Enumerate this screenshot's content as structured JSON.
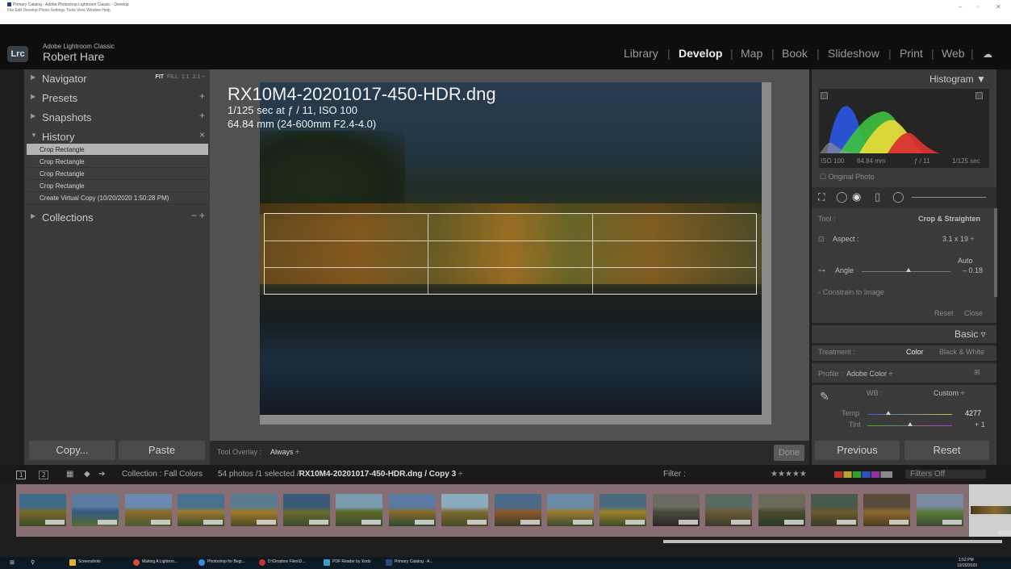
{
  "window": {
    "title": "Primary Catalog - Adobe Photoshop Lightroom Classic - Develop",
    "menu": "File  Edit  Develop  Photo  Settings  Tools  View  Window  Help",
    "controls": [
      "–",
      "▫",
      "✕"
    ]
  },
  "identity": {
    "badge": "Lrc",
    "app_name": "Adobe Lightroom Classic",
    "user_name": "Robert Hare"
  },
  "modules": [
    "Library",
    "Develop",
    "Map",
    "Book",
    "Slideshow",
    "Print",
    "Web"
  ],
  "active_module": "Develop",
  "left_panel": {
    "navigator": "Navigator",
    "nav_options": {
      "fit": "FIT",
      "fill": "FILL",
      "one": "1:1",
      "two": "2:1"
    },
    "presets": "Presets",
    "snapshots": "Snapshots",
    "history": "History",
    "history_items": [
      "Crop Rectangle",
      "Crop Rectangle",
      "Crop Rectangle",
      "Crop Rectangle",
      "Create Virtual Copy (10/20/2020 1:50:28 PM)"
    ],
    "collections": "Collections",
    "copy_button": "Copy...",
    "paste_button": "Paste"
  },
  "photo_info": {
    "filename": "RX10M4-20201017-450-HDR.dng",
    "exposure": "1/125 sec at ƒ / 11, ISO 100",
    "lens": "64.84 mm (24-600mm F2.4-4.0)"
  },
  "toolbar": {
    "overlay_label": "Tool Overlay :",
    "overlay_value": "Always ÷",
    "done": "Done"
  },
  "right_panel": {
    "histogram": "Histogram ▼",
    "hist_meta": [
      "ISO 100",
      "64.84 mm",
      "ƒ / 11",
      "1/125 sec"
    ],
    "original_photo": "Original Photo",
    "tool_label": "Tool :",
    "tool_value": "Crop & Straighten",
    "aspect_label": "Aspect :",
    "aspect_value": "3.1 x 19 ÷",
    "auto": "Auto",
    "angle_label": "Angle",
    "angle_value": "– 0.18",
    "constrain": "Constrain to Image",
    "reset": "Reset",
    "close": "Close",
    "basic": "Basic",
    "treatment_label": "Treatment :",
    "treatment_color": "Color",
    "treatment_bw": "Black & White",
    "profile_label": "Profile :",
    "profile_value": "Adobe Color ÷",
    "wb_label": "WB :",
    "wb_value": "Custom ÷",
    "temp_label": "Temp",
    "temp_value": "4277",
    "tint_label": "Tint",
    "tint_value": "+ 1",
    "previous_button": "Previous",
    "reset_button": "Reset"
  },
  "filmstrip": {
    "collection": "Collection : Fall Colors",
    "info": "54 photos /1 selected /",
    "file": "RX10M4-20201017-450-HDR.dng / Copy 3",
    "file_suffix": " ÷",
    "filter_label": "Filter :",
    "filters_off": "Filters Off",
    "page_1": "1",
    "page_2": "2"
  },
  "taskbar": {
    "items": [
      "Screenshots",
      "Making A Lightroo...",
      "Photoshop for Begi...",
      "D:\\Dropbox Files\\D...",
      "PDF Reader by Xodo",
      "Primary Catalog - A..."
    ],
    "time": "1:52 PM",
    "date": "10/20/2020"
  },
  "colors": {
    "accent_bg": "#1e1e1e",
    "panel": "#3a3a3a",
    "filmstrip": "#886e73"
  }
}
